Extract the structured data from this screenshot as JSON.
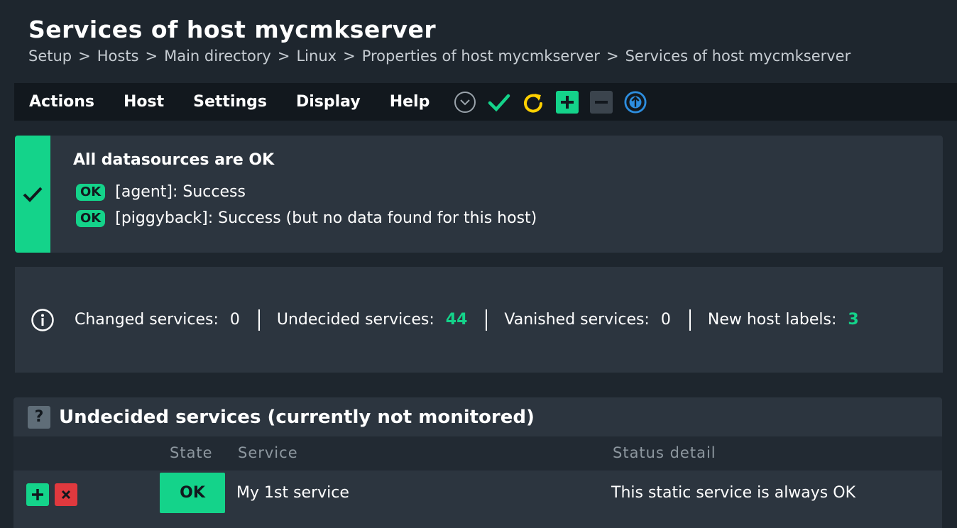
{
  "page": {
    "title": "Services of host mycmkserver",
    "breadcrumb": [
      "Setup",
      "Hosts",
      "Main directory",
      "Linux",
      "Properties of host mycmkserver",
      "Services of host mycmkserver"
    ],
    "breadcrumb_separator": ">"
  },
  "menu": {
    "items": [
      "Actions",
      "Host",
      "Settings",
      "Display",
      "Help"
    ],
    "toolbar_icons": [
      "chevron-down-circle-icon",
      "checkmark-icon",
      "refresh-icon",
      "plus-icon",
      "minus-icon",
      "arrow-up-circle-icon"
    ]
  },
  "datasources": {
    "title": "All datasources are OK",
    "status_icon": "checkmark-icon",
    "lines": [
      {
        "badge": "OK",
        "text": "[agent]: Success"
      },
      {
        "badge": "OK",
        "text": "[piggyback]: Success (but no data found for this host)"
      }
    ]
  },
  "summary": {
    "changed_label": "Changed services:",
    "changed_value": "0",
    "undecided_label": "Undecided services:",
    "undecided_value": "44",
    "vanished_label": "Vanished services:",
    "vanished_value": "0",
    "labels_label": "New host labels:",
    "labels_value": "3"
  },
  "services": {
    "title": "Undecided services (currently not monitored)",
    "icon": "?",
    "columns": {
      "state": "State",
      "service": "Service",
      "detail": "Status detail"
    },
    "rows": [
      {
        "state": "OK",
        "service": "My 1st service",
        "detail": "This static service is always OK"
      }
    ]
  },
  "colors": {
    "accent_green": "#14d38a",
    "background": "#1e262e",
    "panel": "#2c353f",
    "menubar": "#12181e",
    "remove_red": "#e0393e",
    "info_blue": "#2d8dde",
    "refresh_yellow": "#ffd000"
  }
}
